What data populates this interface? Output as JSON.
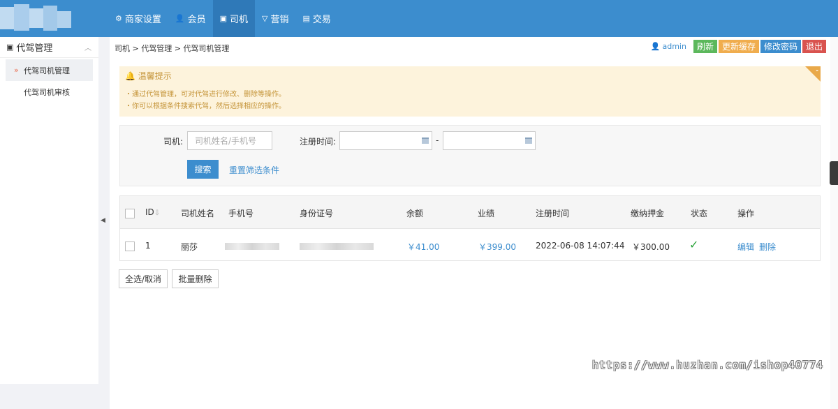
{
  "topnav": {
    "items": [
      {
        "label": "商家设置",
        "icon": "gear-icon",
        "active": false
      },
      {
        "label": "会员",
        "icon": "user-icon",
        "active": false
      },
      {
        "label": "司机",
        "icon": "car-icon",
        "active": true
      },
      {
        "label": "营销",
        "icon": "megaphone-icon",
        "active": false
      },
      {
        "label": "交易",
        "icon": "document-icon",
        "active": false
      }
    ]
  },
  "sidebar": {
    "section_title": "代驾管理",
    "items": [
      {
        "label": "代驾司机管理",
        "active": true
      },
      {
        "label": "代驾司机审核",
        "active": false
      }
    ]
  },
  "breadcrumb": "司机 > 代驾管理 > 代驾司机管理",
  "userbar": {
    "username": "admin",
    "buttons": [
      {
        "label": "刷新",
        "color": "#5cb85c"
      },
      {
        "label": "更新缓存",
        "color": "#f0ad4e"
      },
      {
        "label": "修改密码",
        "color": "#3c8dce"
      },
      {
        "label": "退出",
        "color": "#d9534f"
      }
    ]
  },
  "tips": {
    "title": "温馨提示",
    "lines": [
      "通过代驾管理，可对代驾进行修改、删除等操作。",
      "你可以根据条件搜索代驾，然后选择相应的操作。"
    ]
  },
  "filter": {
    "driver_label": "司机:",
    "driver_placeholder": "司机姓名/手机号",
    "reg_time_label": "注册时间:",
    "date_separator": "-",
    "search_label": "搜索",
    "reset_label": "重置筛选条件"
  },
  "table": {
    "columns": [
      "ID",
      "司机姓名",
      "手机号",
      "身份证号",
      "余额",
      "业绩",
      "注册时间",
      "缴纳押金",
      "状态",
      "操作"
    ],
    "rows": [
      {
        "id": "1",
        "name": "丽莎",
        "balance": "￥41.00",
        "performance": "￥399.00",
        "reg_time": "2022-06-08 14:07:44",
        "deposit": "￥300.00",
        "status_mark": "✓",
        "edit_label": "编辑",
        "delete_label": "删除"
      }
    ]
  },
  "bottom_actions": {
    "select_all": "全选/取消",
    "batch_delete": "批量删除"
  },
  "watermark": "https://www.huzhan.com/ishop40774"
}
